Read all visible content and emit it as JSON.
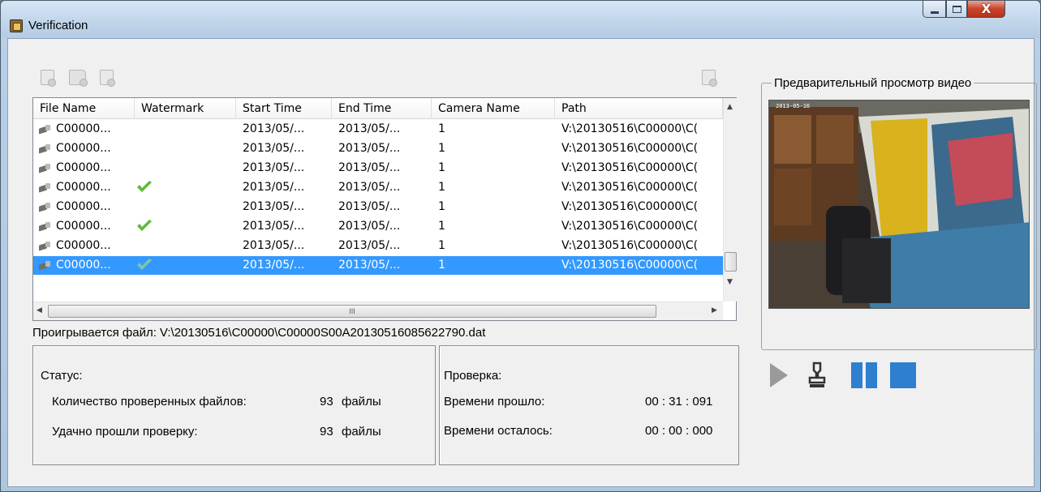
{
  "window": {
    "title": "Verification",
    "controls": {
      "minimize": "minimize",
      "maximize": "maximize",
      "close": "X"
    }
  },
  "toolbar": {
    "left_icons": [
      "add-file-icon",
      "open-folder-icon",
      "save-file-icon"
    ],
    "right_icons": [
      "refresh-file-icon"
    ]
  },
  "file_list": {
    "columns": [
      {
        "label": "File Name"
      },
      {
        "label": "Watermark"
      },
      {
        "label": "Start Time"
      },
      {
        "label": "End Time"
      },
      {
        "label": "Camera Name"
      },
      {
        "label": "Path"
      }
    ],
    "rows": [
      {
        "file_name": "C00000...",
        "watermark": false,
        "start_time": "2013/05/...",
        "end_time": "2013/05/...",
        "camera_name": "1",
        "path": "V:\\20130516\\C00000\\C(",
        "selected": false
      },
      {
        "file_name": "C00000...",
        "watermark": false,
        "start_time": "2013/05/...",
        "end_time": "2013/05/...",
        "camera_name": "1",
        "path": "V:\\20130516\\C00000\\C(",
        "selected": false
      },
      {
        "file_name": "C00000...",
        "watermark": false,
        "start_time": "2013/05/...",
        "end_time": "2013/05/...",
        "camera_name": "1",
        "path": "V:\\20130516\\C00000\\C(",
        "selected": false
      },
      {
        "file_name": "C00000...",
        "watermark": true,
        "start_time": "2013/05/...",
        "end_time": "2013/05/...",
        "camera_name": "1",
        "path": "V:\\20130516\\C00000\\C(",
        "selected": false
      },
      {
        "file_name": "C00000...",
        "watermark": false,
        "start_time": "2013/05/...",
        "end_time": "2013/05/...",
        "camera_name": "1",
        "path": "V:\\20130516\\C00000\\C(",
        "selected": false
      },
      {
        "file_name": "C00000...",
        "watermark": true,
        "start_time": "2013/05/...",
        "end_time": "2013/05/...",
        "camera_name": "1",
        "path": "V:\\20130516\\C00000\\C(",
        "selected": false
      },
      {
        "file_name": "C00000...",
        "watermark": false,
        "start_time": "2013/05/...",
        "end_time": "2013/05/...",
        "camera_name": "1",
        "path": "V:\\20130516\\C00000\\C(",
        "selected": false
      },
      {
        "file_name": "C00000...",
        "watermark": true,
        "start_time": "2013/05/...",
        "end_time": "2013/05/...",
        "camera_name": "1",
        "path": "V:\\20130516\\C00000\\C(",
        "selected": true
      }
    ],
    "hscroll_glyph": "III"
  },
  "playing": {
    "label": "Проигрывается файл:",
    "value": "V:\\20130516\\C00000\\C00000S00A20130516085622790.dat"
  },
  "status": {
    "title": "Статус:",
    "checked_label": "Количество проверенных файлов:",
    "checked_value": "93",
    "checked_unit": "файлы",
    "passed_label": "Удачно прошли проверку:",
    "passed_value": "93",
    "passed_unit": "файлы"
  },
  "verification": {
    "title": "Проверка:",
    "elapsed_label": "Времени прошло:",
    "elapsed_value": "00 : 31 : 091",
    "remaining_label": "Времени осталось:",
    "remaining_value": "00 : 00 : 000"
  },
  "preview": {
    "label": "Предварительный просмотр видео",
    "osd_text": "2013-05-16"
  },
  "playback_controls": [
    "play-icon",
    "stamp-icon",
    "pause-icon",
    "stop-icon"
  ],
  "colors": {
    "selection": "#3399ff",
    "check": "#5dbb3c",
    "control_blue": "#2f7fcf",
    "play_gray": "#9a9a9a"
  }
}
